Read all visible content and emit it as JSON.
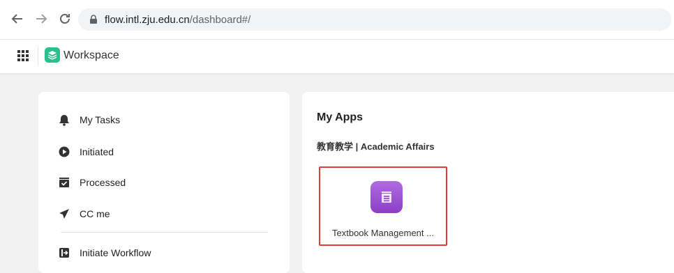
{
  "browser": {
    "url_host": "flow.intl.zju.edu.cn",
    "url_path": "/dashboard#/"
  },
  "header": {
    "title": "Workspace",
    "logo_color": "#2bbf8e"
  },
  "sidebar": {
    "items": [
      {
        "label": "My Tasks",
        "icon": "bell-icon"
      },
      {
        "label": "Initiated",
        "icon": "play-circle-icon"
      },
      {
        "label": "Processed",
        "icon": "inbox-check-icon"
      },
      {
        "label": "CC me",
        "icon": "send-icon"
      },
      {
        "label": "Initiate Workflow",
        "icon": "initiate-workflow-icon"
      }
    ]
  },
  "main": {
    "title": "My Apps",
    "category": "教育教学 | Academic Affairs",
    "apps": [
      {
        "name": "Textbook Management ...",
        "icon": "document-icon",
        "highlight_color": "#e53935"
      }
    ]
  }
}
